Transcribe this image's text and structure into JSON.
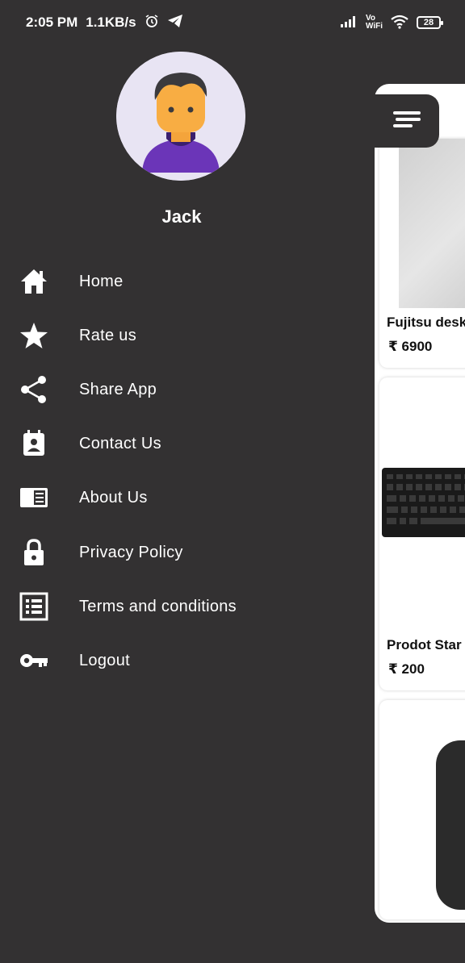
{
  "status_bar": {
    "time": "2:05 PM",
    "speed": "1.1KB/s",
    "volte_top": "Vo",
    "volte_bottom": "WiFi",
    "battery": "28",
    "icons": [
      "alarm-icon",
      "telegram-icon",
      "signal-icon",
      "wifi-icon",
      "battery-icon"
    ]
  },
  "drawer": {
    "user_name": "Jack",
    "menu": [
      {
        "label": "Home",
        "icon": "home-icon"
      },
      {
        "label": "Rate us",
        "icon": "star-icon"
      },
      {
        "label": "Share App",
        "icon": "share-icon"
      },
      {
        "label": "Contact Us",
        "icon": "contact-icon"
      },
      {
        "label": "About Us",
        "icon": "about-icon"
      },
      {
        "label": "Privacy Policy",
        "icon": "lock-icon"
      },
      {
        "label": "Terms and conditions",
        "icon": "list-icon"
      },
      {
        "label": "Logout",
        "icon": "key-icon"
      }
    ]
  },
  "products": [
    {
      "name": "Fujitsu desk",
      "price": "₹ 6900"
    },
    {
      "name": "Prodot Star",
      "price": "₹ 200"
    },
    {
      "name": "",
      "price": ""
    }
  ],
  "colors": {
    "drawer_bg": "#333132",
    "text": "#ffffff",
    "avatar_bg": "#e8e4f3"
  }
}
